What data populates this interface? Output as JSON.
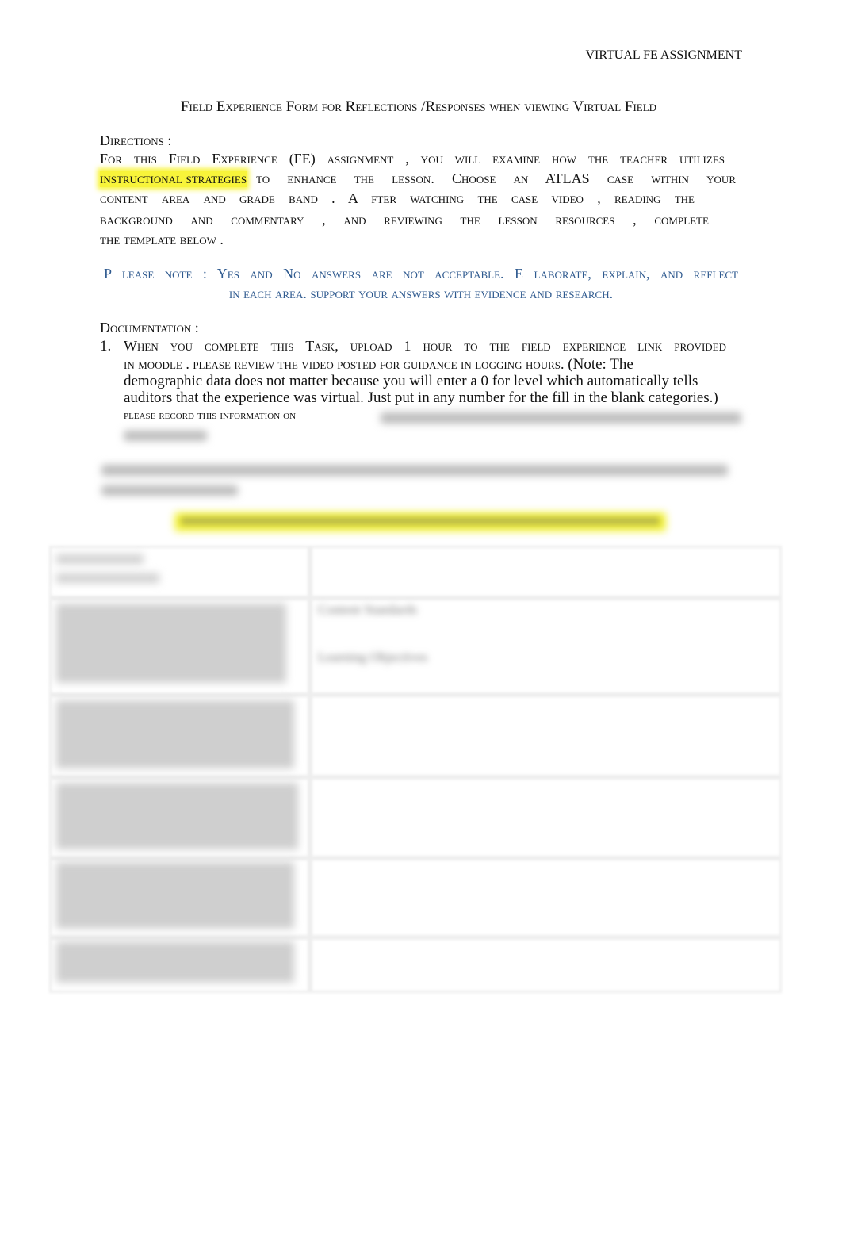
{
  "header": {
    "running_title": "VIRTUAL FE ASSIGNMENT"
  },
  "title": "Field Experience  Form for Reflections /Responses when viewing  Virtual  Field",
  "directions": {
    "heading": "Directions :",
    "line1": "For this Field Experience  (FE) assignment , you will  examine  how  the teacher  utilizes",
    "highlight": "instructional  strategies",
    "line2_rest": "to enhance the lesson. Choose   an  ATLAS   case   within   your",
    "line3": "content   area  and  grade  band . A fter  watching    the  case  video ,  reading   the",
    "line4": "background    and  commentary   ,  and  reviewing   the  lesson   resources   ,  complete",
    "line5": "the  template   below ."
  },
  "note": {
    "line1": "P lease   note :  Yes and No answers  are not  acceptable. E laborate,  explain,  and  reflect",
    "line2": "in each area. support  your answers  with evidence  and research."
  },
  "documentation": {
    "heading": "Documentation  :",
    "item_number": "1.",
    "line1": "When you complete  this Task, upload  1 hour  to the field  experience  link provided",
    "line2_sc": "in moodle . please  review  the video posted  for guidance  in logging  hours.",
    "line2_plain": " (Note: The",
    "line3": "demographic data does not matter because you will enter a 0 for level which automatically tells",
    "line4": "auditors that the experience was virtual. Just put in any number for the fill in the blank categories.)",
    "line5": "please  record  this information   on"
  },
  "table": {
    "cells": [
      "Content Standards",
      "Learning Objectives"
    ]
  },
  "colors": {
    "highlight": "#f8f43a",
    "note_blue": "#2f5a8f"
  }
}
